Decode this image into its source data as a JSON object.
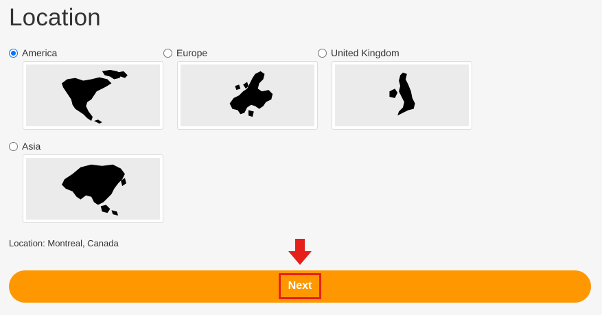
{
  "page": {
    "title": "Location"
  },
  "options": [
    {
      "label": "America",
      "checked": true,
      "icon": "north-america-map-icon"
    },
    {
      "label": "Europe",
      "checked": false,
      "icon": "europe-map-icon"
    },
    {
      "label": "United Kingdom",
      "checked": false,
      "icon": "united-kingdom-map-icon"
    },
    {
      "label": "Asia",
      "checked": false,
      "icon": "asia-map-icon"
    }
  ],
  "location_text": "Location: Montreal, Canada",
  "next_button": {
    "label": "Next"
  },
  "colors": {
    "accent": "#ff9800",
    "highlight": "#e5201b",
    "radio_checked": "#0075ff",
    "map_fill": "#000000",
    "map_background": "#ebebeb"
  }
}
